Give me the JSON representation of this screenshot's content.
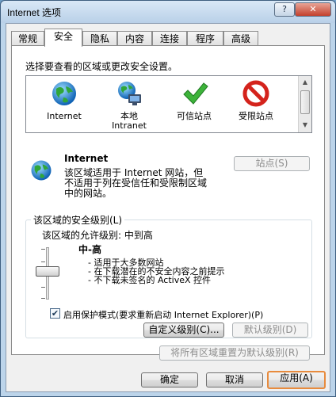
{
  "window": {
    "title": "Internet 选项",
    "help": "?",
    "close": "✕"
  },
  "tabs": [
    "常规",
    "安全",
    "隐私",
    "内容",
    "连接",
    "程序",
    "高级"
  ],
  "zone_prompt": "选择要查看的区域或更改安全设置。",
  "zones": [
    {
      "label": "Internet"
    },
    {
      "label": "本地\nIntranet"
    },
    {
      "label": "可信站点"
    },
    {
      "label": "受限站点"
    }
  ],
  "selected_zone": {
    "name": "Internet",
    "desc": "该区域适用于 Internet 网站，但\n不适用于列在受信任和受限制区域\n中的网站。",
    "sites_button": "站点(S)"
  },
  "security_level": {
    "group_title": "该区域的安全级别(L)",
    "allowed": "该区域的允许级别: 中到高",
    "level_name": "中-高",
    "bullets": [
      "- 适用于大多数网站",
      "- 在下载潜在的不安全内容之前提示",
      "- 不下载未签名的 ActiveX 控件"
    ],
    "protected_mode": "启用保护模式(要求重新启动 Internet Explorer)(P)",
    "protected_mode_checked": true,
    "custom_button": "自定义级别(C)...",
    "default_button": "默认级别(D)",
    "reset_all_button": "将所有区域重置为默认级别(R)"
  },
  "footer": {
    "ok": "确定",
    "cancel": "取消",
    "apply": "应用(A)"
  },
  "colors": {
    "accent_focus": "#e88b3d",
    "title_gradient_top": "#d9e8f6"
  }
}
